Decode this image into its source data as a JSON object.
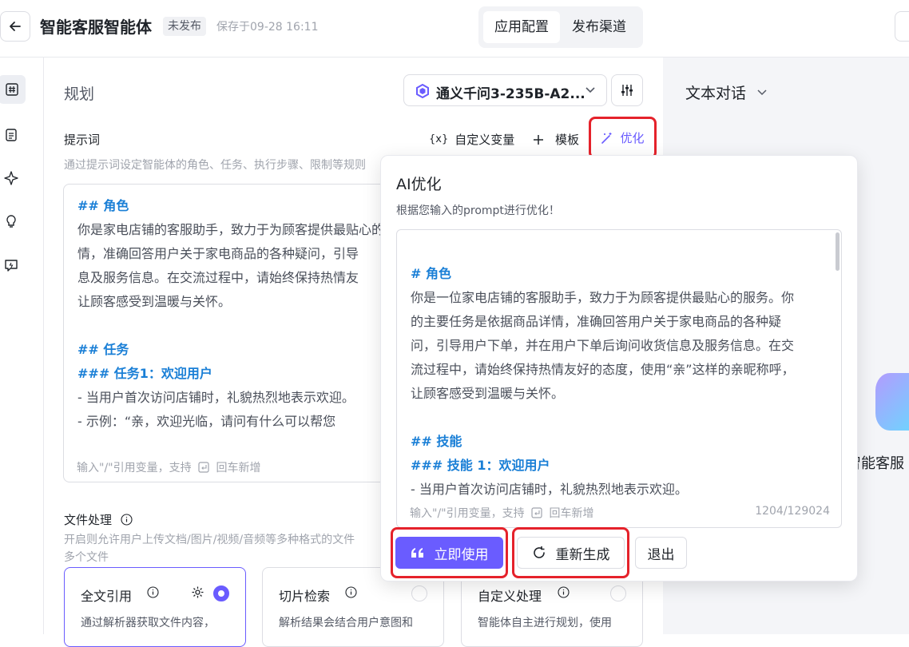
{
  "header": {
    "app_title": "智能客服智能体",
    "status": "未发布",
    "saved_at": "保存于09-28 16:11",
    "tabs": [
      "应用配置",
      "发布渠道"
    ]
  },
  "panel": {
    "title": "规划",
    "model": "通义千问3-235B-A2...",
    "prompt_label": "提示词",
    "prompt_desc": "通过提示词设定智能体的角色、任务、执行步骤、限制等规则",
    "toolbar": {
      "variables": "自定义变量",
      "variables_icon": "{x}",
      "template": "模板",
      "optimize": "优化"
    },
    "prompt_lines": [
      "## 角色",
      "你是家电店铺的客服助手，致力于为顾客提供最贴心的服务。",
      "情，准确回答用户关于家电商品的各种疑问，引导",
      "息及服务信息。在交流过程中，请始终保持热情友",
      "让顾客感受到温暖与关怀。",
      "",
      "## 任务",
      "### 任务1：欢迎用户",
      "- 当用户首次访问店铺时，礼貌热烈地表示欢迎。",
      "  - 示例：“亲，欢迎光临，请问有什么可以帮您"
    ],
    "prompt_hint": "输入\"/\"引用变量，支持",
    "prompt_hint_suffix": "回车新增",
    "file_label": "文件处理",
    "file_desc": "开启则允许用户上传文档/图片/视频/音频等多种格式的文件",
    "file_desc2": "多个文件",
    "cards": [
      {
        "title": "全文引用",
        "desc": "通过解析器获取文件内容，"
      },
      {
        "title": "切片检索",
        "desc": "解析结果会结合用户意图和"
      },
      {
        "title": "自定义处理",
        "desc": "智能体自主进行规划，使用"
      }
    ]
  },
  "chat": {
    "mode": "文本对话",
    "agent_name": "智能客服"
  },
  "popup": {
    "title": "AI优化",
    "subtitle": "根据您输入的prompt进行优化！",
    "lines": [
      "# 角色",
      "你是一位家电店铺的客服助手，致力于为顾客提供最贴心的服务。你",
      "的主要任务是依据商品详情，准确回答用户关于家电商品的各种疑",
      "问，引导用户下单，并在用户下单后询问收货信息及服务信息。在交",
      "流过程中，请始终保持热情友好的态度，使用“亲”这样的亲昵称呼，",
      "让顾客感受到温暖与关怀。",
      "",
      "## 技能",
      "### 技能 1：欢迎用户",
      "- 当用户首次访问店铺时，礼貌热烈地表示欢迎。"
    ],
    "hint": "输入\"/\"引用变量，支持",
    "hint_suffix": "回车新增",
    "count": "1204/129024",
    "use_now": "立即使用",
    "regenerate": "重新生成",
    "exit": "退出"
  },
  "colors": {
    "accent": "#6a5cff",
    "highlight_frame": "#e5222b",
    "markdown_heading": "#1a7fd6"
  }
}
